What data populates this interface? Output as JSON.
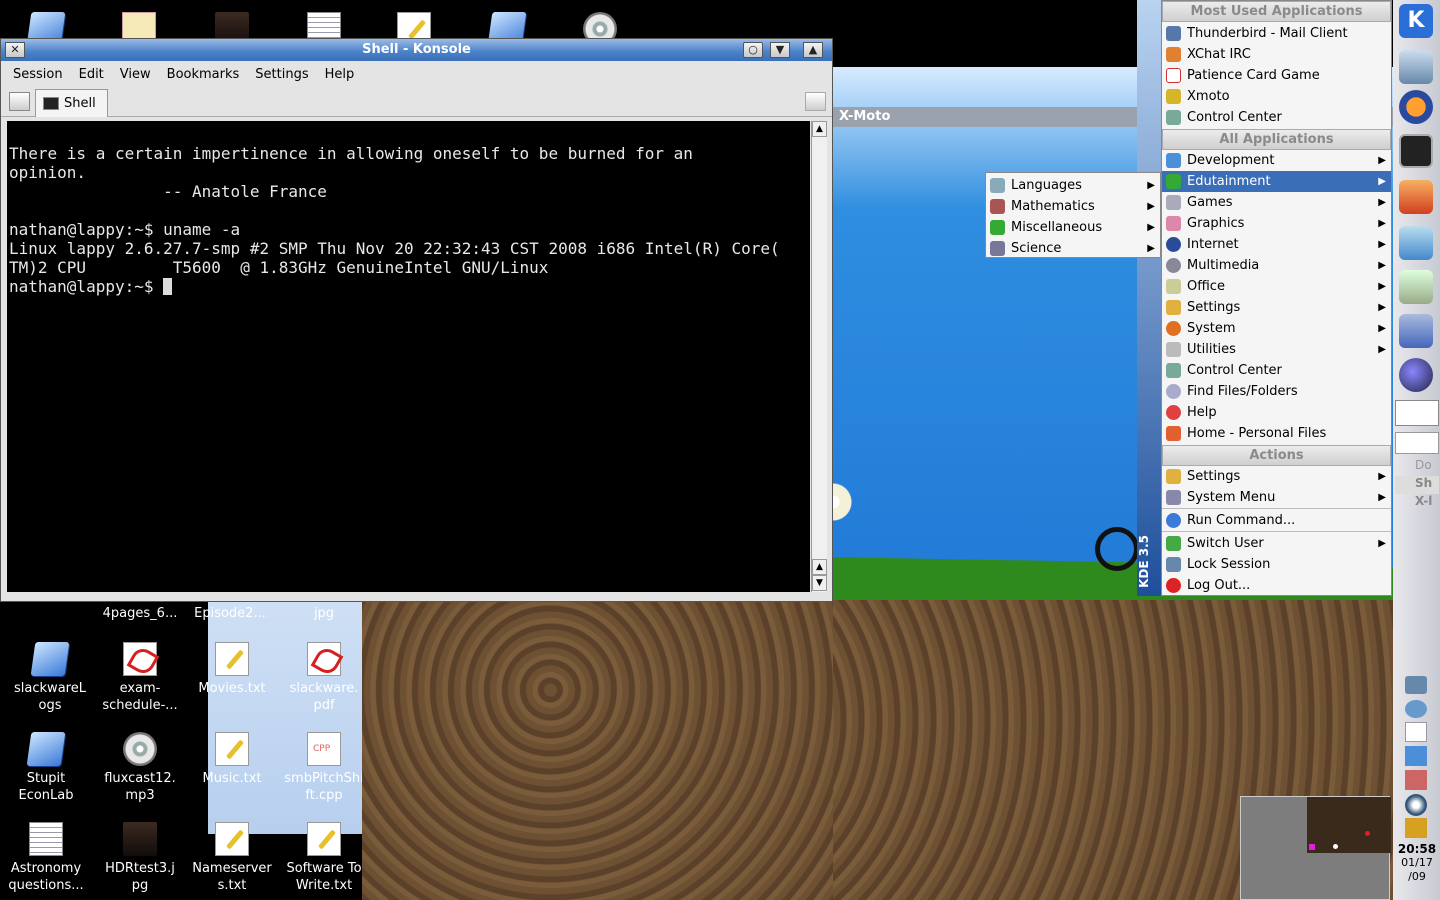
{
  "konsole": {
    "title": "Shell - Konsole",
    "menu": [
      "Session",
      "Edit",
      "View",
      "Bookmarks",
      "Settings",
      "Help"
    ],
    "tab_label": "Shell",
    "terminal_text": "\nThere is a certain impertinence in allowing oneself to be burned for an\nopinion.\n\t\t-- Anatole France\n\nnathan@lappy:~$ uname -a\nLinux lappy 2.6.27.7-smp #2 SMP Thu Nov 20 22:32:43 CST 2008 i686 Intel(R) Core(\nTM)2 CPU         T5600  @ 1.83GHz GenuineIntel GNU/Linux\nnathan@lappy:~$ "
  },
  "xmoto": {
    "title": "X-Moto"
  },
  "desktop_icons": [
    {
      "label": "4pages_6..."
    },
    {
      "label": "Episode2..."
    },
    {
      "label": "jpg"
    },
    {
      "label": "slackwareLogs"
    },
    {
      "label": "exam-schedule-..."
    },
    {
      "label": "Movies.txt"
    },
    {
      "label": "slackware.pdf"
    },
    {
      "label": "Stupit EconLab"
    },
    {
      "label": "fluxcast12.mp3"
    },
    {
      "label": "Music.txt"
    },
    {
      "label": "smbPitchShift.cpp"
    },
    {
      "label": "Astronomy questions..."
    },
    {
      "label": "HDRtest3.jpg"
    },
    {
      "label": "Nameservers.txt"
    },
    {
      "label": "Software To Write.txt"
    }
  ],
  "kmenu": {
    "side_label": "KDE 3.5",
    "most_used_header": "Most Used Applications",
    "most_used": [
      "Thunderbird - Mail Client",
      "XChat IRC",
      "Patience Card Game",
      "Xmoto",
      "Control Center"
    ],
    "all_apps_header": "All Applications",
    "all_apps": [
      "Development",
      "Edutainment",
      "Games",
      "Graphics",
      "Internet",
      "Multimedia",
      "Office",
      "Settings",
      "System",
      "Utilities",
      "Control Center",
      "Find Files/Folders",
      "Help",
      "Home - Personal Files"
    ],
    "actions_header": "Actions",
    "actions": [
      "Settings",
      "System Menu",
      "Run Command...",
      "Switch User",
      "Lock Session",
      "Log Out..."
    ],
    "selected": "Edutainment"
  },
  "submenu": [
    "Languages",
    "Mathematics",
    "Miscellaneous",
    "Science"
  ],
  "taskbar": {
    "items": [
      "Do",
      "Sh",
      "X-l"
    ]
  },
  "clock": {
    "time": "20:58",
    "date1": "01/17",
    "date2": "/09"
  },
  "colors": {
    "accent": "#3a6fb8",
    "title_gradient": "#4a80c8"
  }
}
